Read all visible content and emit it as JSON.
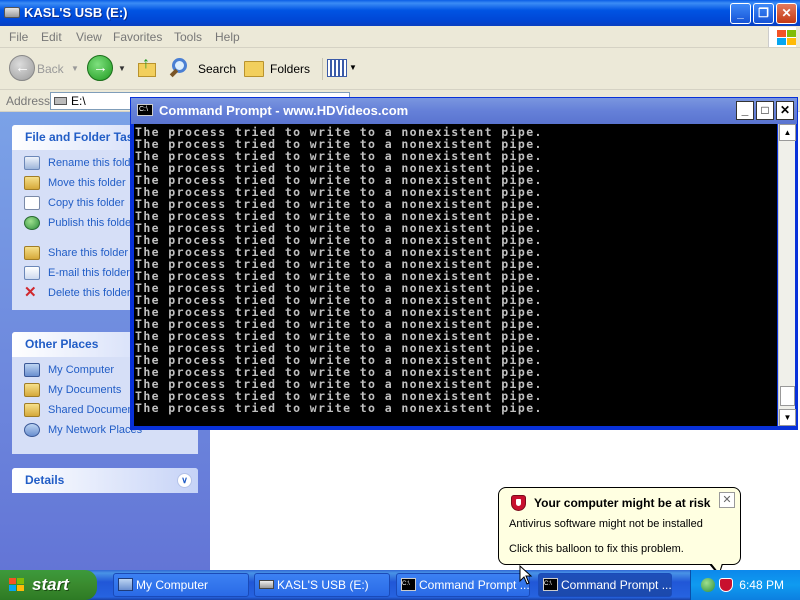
{
  "explorer": {
    "title": "KASL'S USB (E:)",
    "menu": [
      "File",
      "Edit",
      "View",
      "Favorites",
      "Tools",
      "Help"
    ],
    "toolbar": {
      "back_label": "Back",
      "search_label": "Search",
      "folders_label": "Folders"
    },
    "address": {
      "label": "Address",
      "value": "E:\\"
    }
  },
  "taskpane": {
    "file_folder_tasks": {
      "title": "File and Folder Tasks",
      "items": [
        {
          "label": "Rename this folder",
          "icon": "rename-icon"
        },
        {
          "label": "Move this folder",
          "icon": "move-icon"
        },
        {
          "label": "Copy this folder",
          "icon": "copy-icon"
        },
        {
          "label": "Publish this folder to the Web",
          "icon": "web-publish-icon"
        },
        {
          "label": "Share this folder",
          "icon": "share-icon"
        },
        {
          "label": "E-mail this folder's files",
          "icon": "email-icon"
        },
        {
          "label": "Delete this folder",
          "icon": "delete-icon"
        }
      ]
    },
    "other_places": {
      "title": "Other Places",
      "items": [
        {
          "label": "My Computer",
          "icon": "computer-icon"
        },
        {
          "label": "My Documents",
          "icon": "documents-folder-icon"
        },
        {
          "label": "Shared Documents",
          "icon": "shared-folder-icon"
        },
        {
          "label": "My Network Places",
          "icon": "network-icon"
        }
      ]
    },
    "details": {
      "title": "Details"
    }
  },
  "cmd": {
    "title": "Command Prompt - www.HDVideos.com",
    "lines": [
      "The process tried to write to a nonexistent pipe.",
      "The process tried to write to a nonexistent pipe.",
      "The process tried to write to a nonexistent pipe.",
      "The process tried to write to a nonexistent pipe.",
      "The process tried to write to a nonexistent pipe.",
      "The process tried to write to a nonexistent pipe.",
      "The process tried to write to a nonexistent pipe.",
      "The process tried to write to a nonexistent pipe.",
      "The process tried to write to a nonexistent pipe.",
      "The process tried to write to a nonexistent pipe.",
      "The process tried to write to a nonexistent pipe.",
      "The process tried to write to a nonexistent pipe.",
      "The process tried to write to a nonexistent pipe.",
      "The process tried to write to a nonexistent pipe.",
      "The process tried to write to a nonexistent pipe.",
      "The process tried to write to a nonexistent pipe.",
      "The process tried to write to a nonexistent pipe.",
      "The process tried to write to a nonexistent pipe.",
      "The process tried to write to a nonexistent pipe.",
      "The process tried to write to a nonexistent pipe.",
      "The process tried to write to a nonexistent pipe.",
      "The process tried to write to a nonexistent pipe.",
      "The process tried to write to a nonexistent pipe.",
      "The process tried to write to a nonexistent pipe."
    ]
  },
  "balloon": {
    "title": "Your computer might be at risk",
    "line1": "Antivirus software might not be installed",
    "line2": "Click this balloon to fix this problem."
  },
  "taskbar": {
    "start_label": "start",
    "tasks": [
      {
        "label": "My Computer",
        "icon": "computer-icon"
      },
      {
        "label": "KASL'S USB (E:)",
        "icon": "drive-icon"
      },
      {
        "label": "Command Prompt ...",
        "icon": "cmd-icon"
      },
      {
        "label": "Command Prompt ...",
        "icon": "cmd-icon"
      }
    ],
    "clock": "6:48 PM"
  },
  "colors": {
    "xp_blue": "#0054e3",
    "task_pane_link": "#215dc6",
    "balloon_bg": "#ffffe1",
    "console_text": "#c0c0c0"
  }
}
